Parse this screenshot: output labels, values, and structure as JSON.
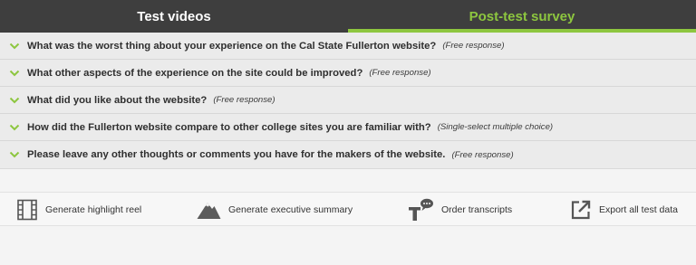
{
  "tabs": [
    {
      "label": "Test videos",
      "active": false
    },
    {
      "label": "Post-test survey",
      "active": true
    }
  ],
  "questions": [
    {
      "text": "What was the worst thing about your experience on the Cal State Fullerton website?",
      "type": "(Free response)"
    },
    {
      "text": "What other aspects of the experience on the site could be improved?",
      "type": "(Free response)"
    },
    {
      "text": "What did you like about the website?",
      "type": "(Free response)"
    },
    {
      "text": "How did the Fullerton website compare to other college sites you are familiar with?",
      "type": "(Single-select multiple choice)"
    },
    {
      "text": "Please leave any other thoughts or comments you have for the makers of the website.",
      "type": "(Free response)"
    }
  ],
  "actions": [
    {
      "label": "Generate highlight reel",
      "icon": "film-strip-icon"
    },
    {
      "label": "Generate executive summary",
      "icon": "mountain-icon"
    },
    {
      "label": "Order transcripts",
      "icon": "transcript-icon"
    },
    {
      "label": "Export all test data",
      "icon": "export-icon"
    }
  ],
  "colors": {
    "accent": "#8dc63f",
    "tabbar": "#3e3e3e",
    "text": "#2f2f2f"
  }
}
